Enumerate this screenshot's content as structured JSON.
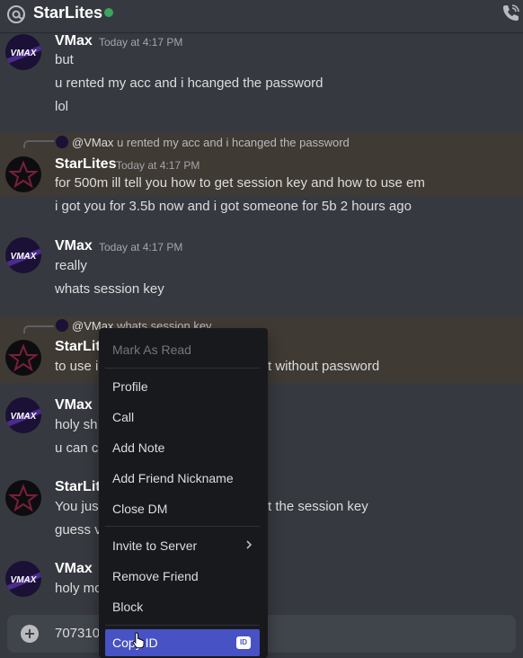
{
  "header": {
    "channel_name": "StarLites",
    "status_color": "#3ba55d",
    "at_icon": "at-icon",
    "call_icon": "voice-call-icon"
  },
  "messages": [
    {
      "author": "VMax",
      "timestamp": "Today at 4:17 PM",
      "lines": [
        "but",
        "u rented my acc and i hcanged the password",
        "lol"
      ]
    },
    {
      "reply_to": {
        "author": "@VMax",
        "text": "u rented my acc and i hcanged the password"
      },
      "author": "StarLites",
      "timestamp": "Today at 4:17 PM",
      "lines": [
        "for 500m ill tell you how  to get session key and how to use em",
        "i got you for 3.5b now and i got someone for 5b 2 hours ago"
      ]
    },
    {
      "author": "VMax",
      "timestamp": "Today at 4:17 PM",
      "lines": [
        "really",
        "whats session key"
      ]
    },
    {
      "reply_to": {
        "author": "@VMax",
        "text": "whats session key"
      },
      "author": "StarLites",
      "lines": [
        "to use i",
        "t without password"
      ]
    },
    {
      "author": "VMax",
      "lines": [
        "holy sh",
        "u can  c"
      ]
    },
    {
      "author": "StarLite",
      "lines": [
        "You jus",
        "t the session key",
        "guess v"
      ]
    },
    {
      "author": "VMax",
      "lines": [
        "holy mo"
      ]
    }
  ],
  "composer": {
    "value": "707310",
    "add_icon": "plus-circle-icon"
  },
  "context_menu": {
    "items": [
      {
        "label": "Mark As Read",
        "disabled": true
      },
      {
        "label": "Profile"
      },
      {
        "label": "Call"
      },
      {
        "label": "Add Note"
      },
      {
        "label": "Add Friend Nickname"
      },
      {
        "label": "Close DM"
      },
      {
        "label": "Invite to Server",
        "submenu": true
      },
      {
        "label": "Remove Friend"
      },
      {
        "label": "Block"
      },
      {
        "label": "Copy ID",
        "highlighted": true,
        "badge": "ID"
      }
    ],
    "highlight_color": "#4752c4"
  },
  "avatars": {
    "vmax_text": "VMAX",
    "vmax_color": "#1b1035",
    "starlites_color": "#0d0d10"
  }
}
